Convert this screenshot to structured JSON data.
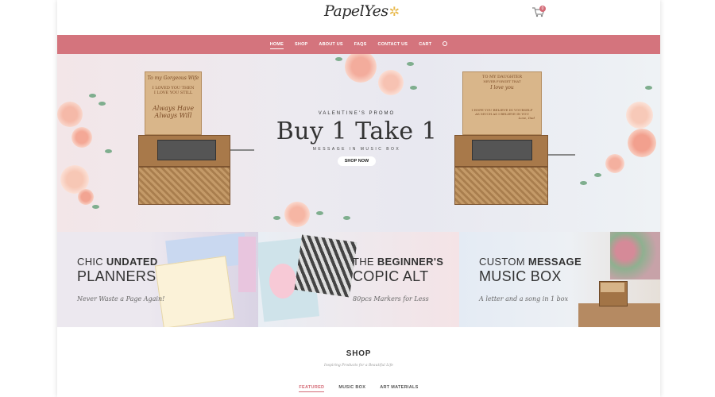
{
  "header": {
    "logo_text": "PapelYes",
    "cart_count": "0"
  },
  "nav": {
    "items": [
      "HOME",
      "SHOP",
      "ABOUT US",
      "FAQS",
      "CONTACT US",
      "CART"
    ]
  },
  "hero": {
    "kicker": "VALENTINE'S PROMO",
    "title": "Buy 1 Take 1",
    "subtitle": "MESSAGE IN MUSIC BOX",
    "button": "SHOP NOW",
    "box_left_lines": [
      "To my Gorgeous Wife",
      "I LOVED YOU THEN",
      "I LOVE YOU STILL",
      "Always Have",
      "Always Will"
    ],
    "box_right_lines": [
      "TO MY DAUGHTER",
      "NEVER FORGET THAT",
      "I love you",
      "I HOPE YOU BELIEVE IN YOURSELF",
      "AS MUCH AS I BELIEVE IN YOU",
      "Love, Dad"
    ]
  },
  "tiles": [
    {
      "line1_a": "CHIC ",
      "line1_b": "UNDATED",
      "line2": "PLANNERS",
      "tag": "Never Waste a Page Again!"
    },
    {
      "line1_a": "THE ",
      "line1_b": "BEGINNER'S",
      "line2": "COPIC ALT",
      "tag": "80pcs Markers for Less"
    },
    {
      "line1_a": "CUSTOM ",
      "line1_b": "MESSAGE",
      "line2": "MUSIC BOX",
      "tag": "A letter and a song in 1 box"
    }
  ],
  "shop": {
    "title": "SHOP",
    "tagline": "Inspiring Products for a Beautiful Life",
    "tabs": [
      "FEATURED",
      "MUSIC BOX",
      "ART MATERIALS"
    ]
  },
  "colors": {
    "nav_bg": "#d4747d",
    "accent": "#d46b77"
  }
}
